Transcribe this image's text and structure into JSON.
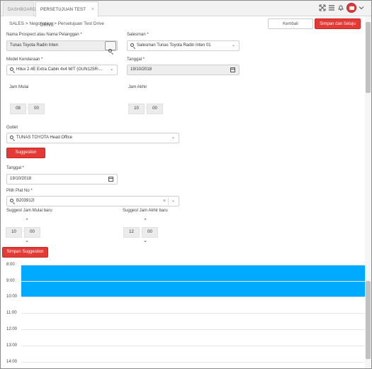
{
  "tabs": [
    {
      "label": "DASHBOARD"
    },
    {
      "label": "PERSETUJUAN TEST DRIVE",
      "close": "×"
    }
  ],
  "header_icons": [
    "expand-icon",
    "menu-icon",
    "bell-icon",
    "avatar",
    "chevron-down-icon"
  ],
  "breadcrumb": {
    "root": "SALES",
    "sep1": ">",
    "mid": "Negotiation",
    "sep2": ">",
    "current": "Persetujuan Test Drive"
  },
  "actions": {
    "back": "Kembali",
    "save": "Simpan dan Setuju"
  },
  "form": {
    "prospect_label": "Nama Prospect atau Nama Pelanggan *",
    "prospect_value": "Tunas Toyota Radin Inten",
    "salesman_label": "Salesman *",
    "salesman_value": "Salesman Tunas Toyota Radin Inten 01",
    "model_label": "Model Kendaraan *",
    "model_value": "Hilux 2.4E Extra Cabin 4x4 M/T (GUN125R-...",
    "tanggal_label": "Tanggal *",
    "tanggal_value": "19/10/2018",
    "jam_mulai_label": "Jam Mulai",
    "jam_mulai_h": "08",
    "jam_mulai_m": "00",
    "jam_akhir_label": "Jam Akhir",
    "jam_akhir_h": "10",
    "jam_akhir_m": "00",
    "outlet_label": "Outlet",
    "outlet_value": "TUNAS TOYOTA Head Office",
    "suggestion_btn": "Suggestion",
    "tanggal2_label": "Tanggal *",
    "tanggal2_value": "19/10/2018",
    "plat_label": "Pilih Plat No *",
    "plat_value": "B203912I",
    "sugg_mulai_label": "Suggest Jam Mulai baru",
    "sugg_mulai_h": "10",
    "sugg_mulai_m": "00",
    "sugg_akhir_label": "Suggest Jam Akhir baru",
    "sugg_akhir_h": "12",
    "sugg_akhir_m": "00",
    "save_suggestion_btn": "Simpan Suggestion",
    "colon": ":"
  },
  "calendar": {
    "hours": [
      "8:00",
      "9:00",
      "10:00",
      "11:00",
      "12:00",
      "13:00",
      "14:00"
    ],
    "event_color": "#00aaff"
  },
  "colors": {
    "accent": "#e53935",
    "event": "#00aaff"
  }
}
